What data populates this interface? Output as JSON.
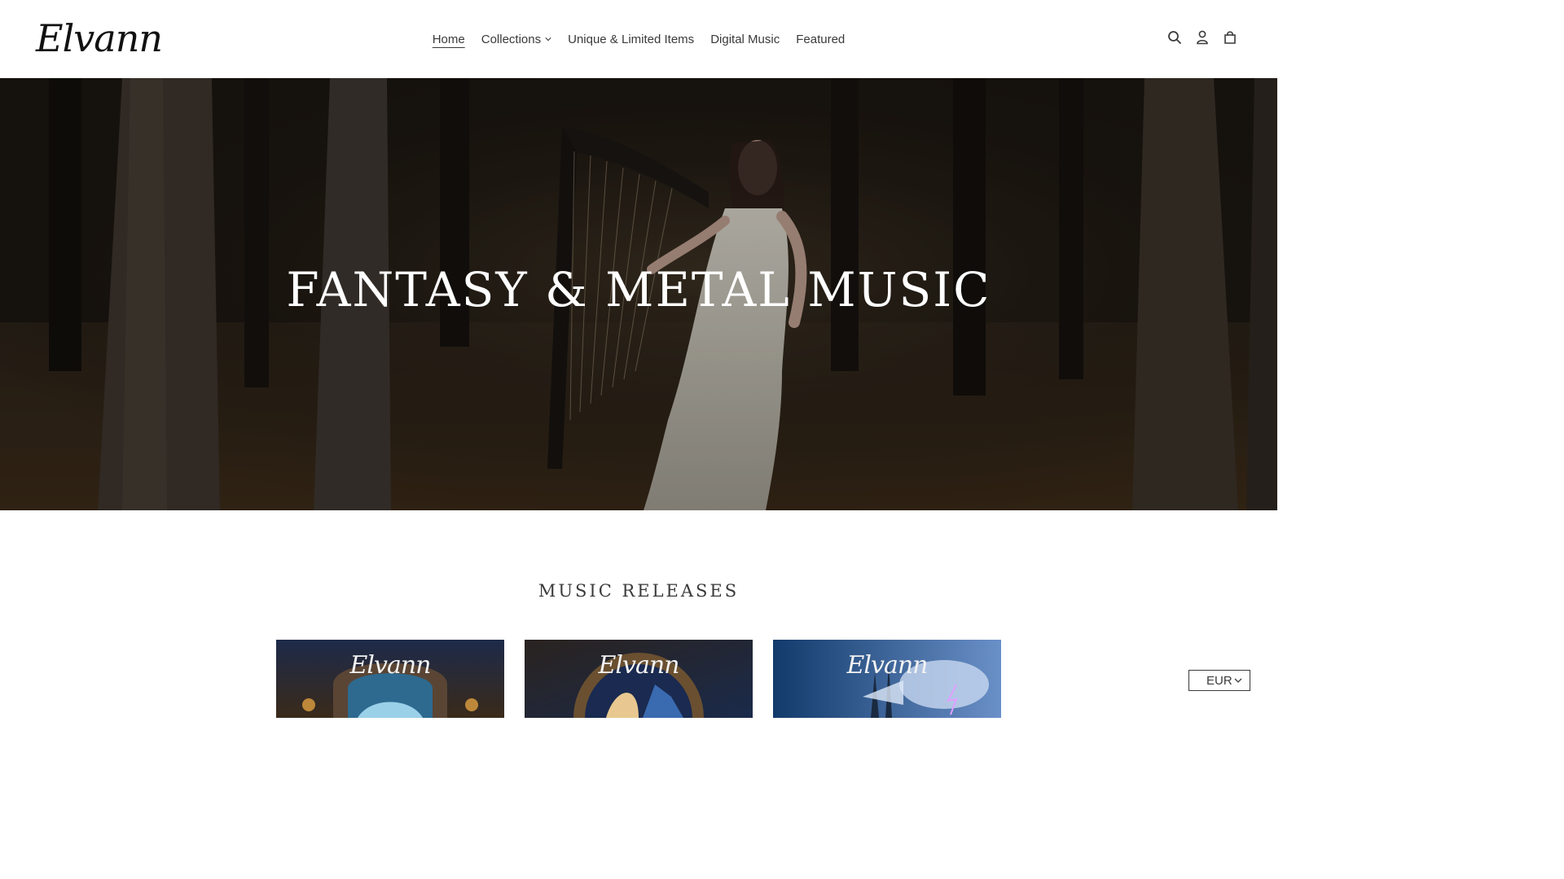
{
  "brand": {
    "logo_text": "Elvann"
  },
  "nav": {
    "items": [
      {
        "label": "Home",
        "active": true
      },
      {
        "label": "Collections",
        "has_dropdown": true
      },
      {
        "label": "Unique & Limited Items"
      },
      {
        "label": "Digital Music"
      },
      {
        "label": "Featured"
      }
    ]
  },
  "header_icons": [
    "search-icon",
    "account-icon",
    "cart-icon"
  ],
  "hero": {
    "title": "Fantasy & Metal Music"
  },
  "releases": {
    "title": "MUSIC RELEASES",
    "items": [
      {
        "brand": "Elvann"
      },
      {
        "brand": "Elvann"
      },
      {
        "brand": "Elvann"
      }
    ]
  },
  "currency": {
    "selected": "EUR"
  },
  "colors": {
    "text": "#3a3a3a",
    "background": "#ffffff",
    "hero_overlay": "#1e1712"
  }
}
